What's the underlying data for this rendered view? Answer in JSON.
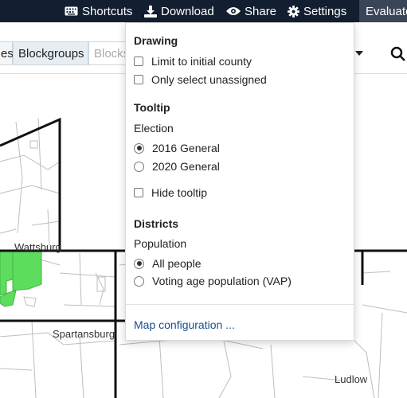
{
  "topbar": {
    "shortcuts": "Shortcuts",
    "download": "Download",
    "share": "Share",
    "settings": "Settings",
    "evaluate": "Evaluate"
  },
  "toolbar": {
    "seg_left": "es",
    "seg_active": "Blockgroups",
    "seg_dim": "Blocks"
  },
  "map": {
    "labels": {
      "wattsburg": "Wattsburg",
      "spartansburg": "Spartansburg",
      "ludlow": "Ludlow"
    },
    "colors": {
      "assigned": "#5ddc5d",
      "boundary": "#111111",
      "blockline": "#bdbdbd"
    }
  },
  "menu": {
    "drawing": {
      "title": "Drawing",
      "options": [
        "Limit to initial county",
        "Only select unassigned"
      ]
    },
    "tooltip": {
      "title": "Tooltip",
      "subtitle": "Election",
      "elections": [
        "2016 General",
        "2020 General"
      ],
      "selected_election": "2016 General",
      "hide": "Hide tooltip"
    },
    "districts": {
      "title": "Districts",
      "subtitle": "Population",
      "options": [
        "All people",
        "Voting age population (VAP)"
      ],
      "selected": "All people"
    },
    "map_config_link": "Map configuration ..."
  }
}
